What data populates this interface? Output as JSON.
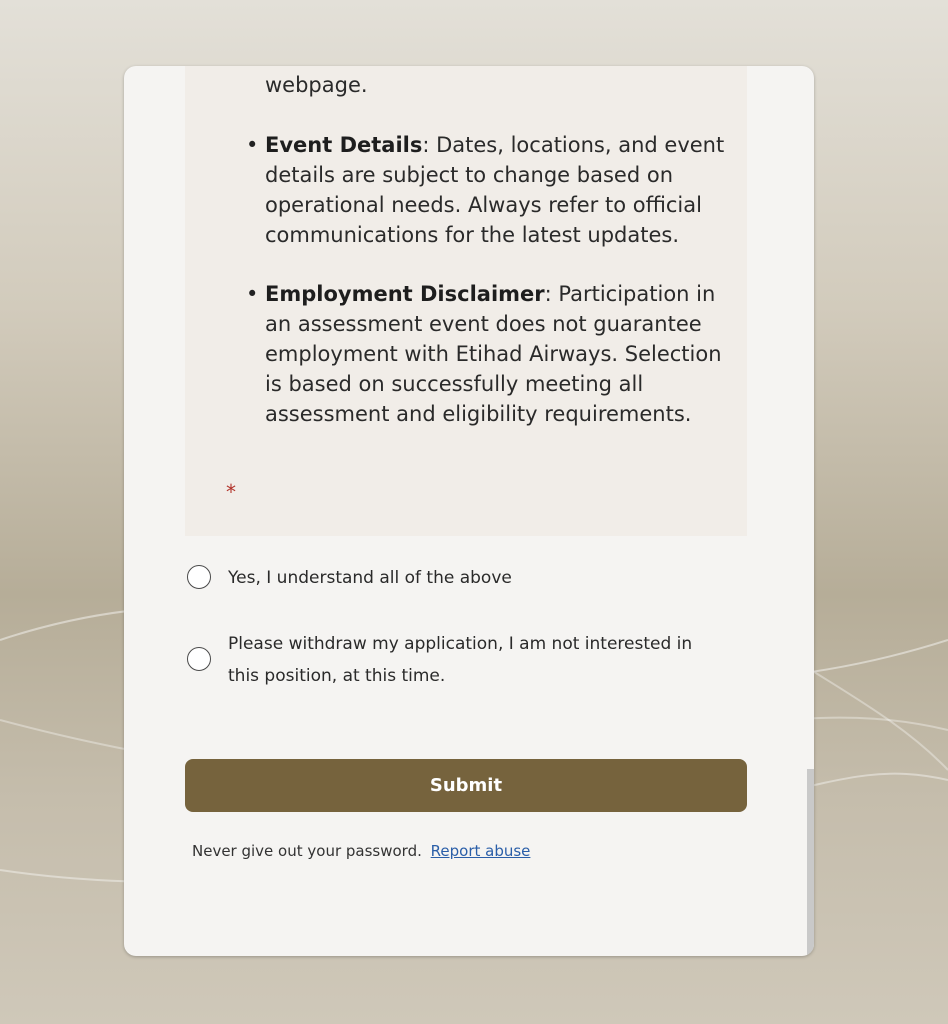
{
  "form": {
    "intro_tail": "webpage.",
    "bullets": [
      {
        "title": "Event Details",
        "text": ": Dates, locations, and event details are subject to change based on operational needs. Always refer to official communications for the latest updates."
      },
      {
        "title": "Employment Disclaimer",
        "text": ": Participation in an assessment event does not guarantee employment with Etihad Airways. Selection is based on successfully meeting all assessment and eligibility requirements."
      }
    ],
    "required_marker": "*",
    "options": [
      {
        "label": "Yes, I understand all of the above",
        "selected": false
      },
      {
        "label": "Please withdraw my application, I am not interested in this position, at this time.",
        "selected": false
      }
    ],
    "submit_label": "Submit"
  },
  "footer": {
    "notice": "Never give out your password.",
    "report_link": "Report abuse"
  },
  "colors": {
    "submit_bg": "#76633d",
    "required": "#b2342b",
    "link": "#2a5ea8",
    "info_bg": "#f1ede8"
  }
}
